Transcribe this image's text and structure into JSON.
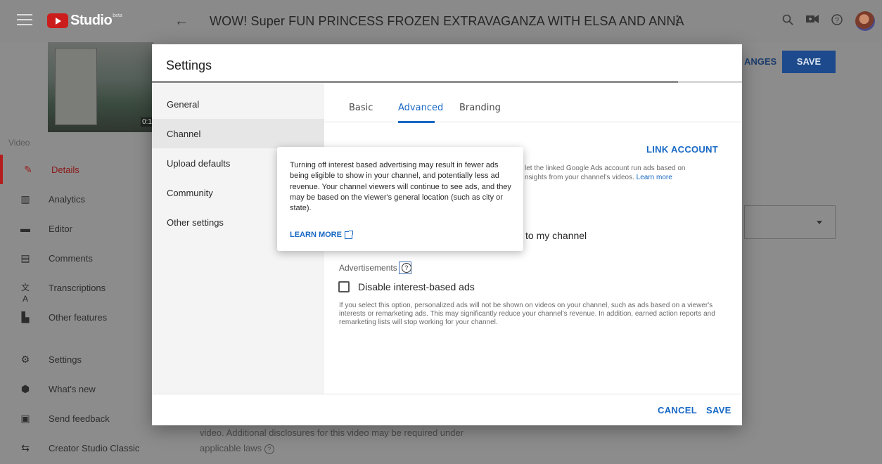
{
  "header": {
    "logo_text": "Studio",
    "logo_badge": "beta",
    "back_glyph": "←",
    "video_title": "WOW! Super FUN PRINCESS FROZEN EXTRAVAGANZA WITH ELSA AND ANNA",
    "more_glyph": "⋮",
    "icons": [
      "search-icon",
      "create-video-icon",
      "help-icon",
      "avatar"
    ]
  },
  "sidebar": {
    "thumbnail_duration": "0:1",
    "section_label": "Video",
    "items": [
      {
        "label": "Details",
        "icon": "pencil-icon",
        "glyph": "✎",
        "active": true
      },
      {
        "label": "Analytics",
        "icon": "analytics-icon",
        "glyph": "▥"
      },
      {
        "label": "Editor",
        "icon": "editor-icon",
        "glyph": "▬"
      },
      {
        "label": "Comments",
        "icon": "comments-icon",
        "glyph": "▤"
      },
      {
        "label": "Transcriptions",
        "icon": "translate-icon",
        "glyph": "文A"
      },
      {
        "label": "Other features",
        "icon": "other-features-icon",
        "glyph": "▙"
      },
      {
        "label": "Settings",
        "icon": "gear-icon",
        "glyph": "⚙"
      },
      {
        "label": "What's new",
        "icon": "whats-new-icon",
        "glyph": "⬢"
      },
      {
        "label": "Send feedback",
        "icon": "feedback-icon",
        "glyph": "▣"
      },
      {
        "label": "Creator Studio Classic",
        "icon": "classic-icon",
        "glyph": "⇆"
      }
    ]
  },
  "background": {
    "changes_label": "ANGES",
    "save_label": "SAVE",
    "disclosure_line1": "video. Additional disclosures for this video may be required under",
    "disclosure_line2": "applicable laws"
  },
  "dialog": {
    "title": "Settings",
    "nav": [
      {
        "label": "General"
      },
      {
        "label": "Channel",
        "active": true
      },
      {
        "label": "Upload defaults"
      },
      {
        "label": "Community"
      },
      {
        "label": "Other settings"
      }
    ],
    "tabs": [
      {
        "label": "Basic"
      },
      {
        "label": "Advanced",
        "active": true
      },
      {
        "label": "Branding"
      }
    ],
    "link_account_label": "LINK ACCOUNT",
    "gads_desc_line1": "let the linked Google Ads account run ads based on",
    "gads_desc_line2": "nsights from your channel's videos.",
    "gads_learn_more": "Learn more",
    "link_to_channel_text": "to my channel",
    "ads_label": "Advertisements",
    "disable_ads_label": "Disable interest-based ads",
    "ads_description": "If you select this option, personalized ads will not be shown on videos on your channel, such as ads based on a viewer's interests or remarketing ads. This may significantly reduce your channel's revenue. In addition, earned action reports and remarketing lists will stop working for your channel.",
    "cancel_label": "CANCEL",
    "save_label": "SAVE"
  },
  "tooltip": {
    "text": "Turning off interest based advertising may result in fewer ads being eligible to show in your channel, and potentially less ad revenue. Your channel viewers will continue to see ads, and they may be based on the viewer's general location (such as city or state).",
    "learn_more": "LEARN MORE"
  },
  "colors": {
    "accent": "#1768c4",
    "active_nav": "#b41d1d",
    "scrim": "#8c8c8c"
  }
}
